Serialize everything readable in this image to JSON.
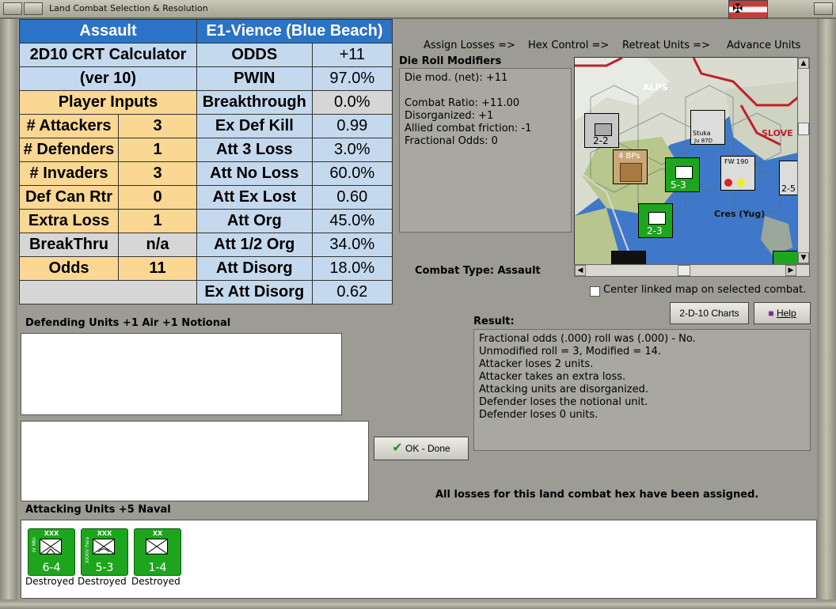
{
  "window": {
    "title": "Land Combat Selection & Resolution"
  },
  "crt": {
    "headers": {
      "left": "Assault",
      "right": "E1-Vience (Blue Beach)"
    },
    "calc_title_1": "2D10 CRT Calculator",
    "calc_title_2": "(ver 10)",
    "player_inputs": "Player Inputs",
    "inputs": [
      {
        "label": "# Attackers",
        "value": "3"
      },
      {
        "label": "# Defenders",
        "value": "1"
      },
      {
        "label": "# Invaders",
        "value": "3"
      },
      {
        "label": "Def Can Rtr",
        "value": "0"
      },
      {
        "label": "Extra Loss",
        "value": "1"
      },
      {
        "label": "BreakThru",
        "value": "n/a"
      },
      {
        "label": "Odds",
        "value": "11"
      }
    ],
    "results": [
      {
        "label": "ODDS",
        "value": "+11"
      },
      {
        "label": "PWIN",
        "value": "97.0%"
      },
      {
        "label": "Breakthrough",
        "value": "0.0%"
      },
      {
        "label": "Ex Def Kill",
        "value": "0.99"
      },
      {
        "label": "Att 3 Loss",
        "value": "3.0%"
      },
      {
        "label": "Att No Loss",
        "value": "60.0%"
      },
      {
        "label": "Att Ex Lost",
        "value": "0.60"
      },
      {
        "label": "Att Org",
        "value": "45.0%"
      },
      {
        "label": "Att 1/2 Org",
        "value": "34.0%"
      },
      {
        "label": "Att Disorg",
        "value": "18.0%"
      },
      {
        "label": "Ex Att Disorg",
        "value": "0.62"
      }
    ]
  },
  "menu": {
    "assign_losses": "Assign Losses =>",
    "hex_control": "Hex Control =>",
    "retreat_units": "Retreat Units =>",
    "advance_units": "Advance Units"
  },
  "die_roll": {
    "label": "Die Roll Modifiers",
    "lines": [
      "Die mod. (net): +11",
      "",
      "Combat Ratio: +11.00",
      "Disorganized: +1",
      "Allied combat friction: -1",
      "Fractional Odds: 0"
    ]
  },
  "map": {
    "labels": {
      "alps": "ALPS",
      "slov": "SLOVE",
      "cres": "Cres (Yug)",
      "bps": "4 BPs"
    },
    "counters": {
      "militia_str": "2-2",
      "para_str": "5-3",
      "inf_str": "2-3",
      "fw190": "FW 190",
      "stuka": "Stuka",
      "ju87": "Ju 87D",
      "ffl_str": "2-5"
    }
  },
  "center_map_label": "Center linked map on selected combat.",
  "combat_type": {
    "label": "Combat Type:",
    "value": "Assault"
  },
  "buttons": {
    "charts": "2-D-10 Charts",
    "help": "Help",
    "ok": "OK - Done"
  },
  "result": {
    "label": "Result:",
    "lines": [
      "Fractional odds (.000) roll was (.000)  - No.",
      "Unmodified roll = 3, Modified = 14.",
      "Attacker loses 2 units.",
      "Attacker takes an extra loss.",
      "Attacking units are disorganized.",
      "Defender loses the notional unit.",
      "Defender loses 0 units."
    ]
  },
  "defending_label": "Defending Units +1 Air +1 Notional",
  "attacking_label": "Attacking Units +5 Naval",
  "all_losses": "All losses for this land combat hex have been assigned.",
  "attackers": [
    {
      "size": "XXX",
      "name": "IV Mtn",
      "strength": "6-4",
      "status": "Destroyed"
    },
    {
      "size": "XXX",
      "name": "XXXIV Para",
      "strength": "5-3",
      "status": "Destroyed"
    },
    {
      "size": "XX",
      "name": "",
      "strength": "1-4",
      "status": "Destroyed"
    }
  ],
  "colors": {
    "crt_blue": "#2b73c6",
    "crt_lightblue": "#c5d9ee",
    "crt_tan": "#fad793",
    "unit_green": "#1ea51e"
  }
}
